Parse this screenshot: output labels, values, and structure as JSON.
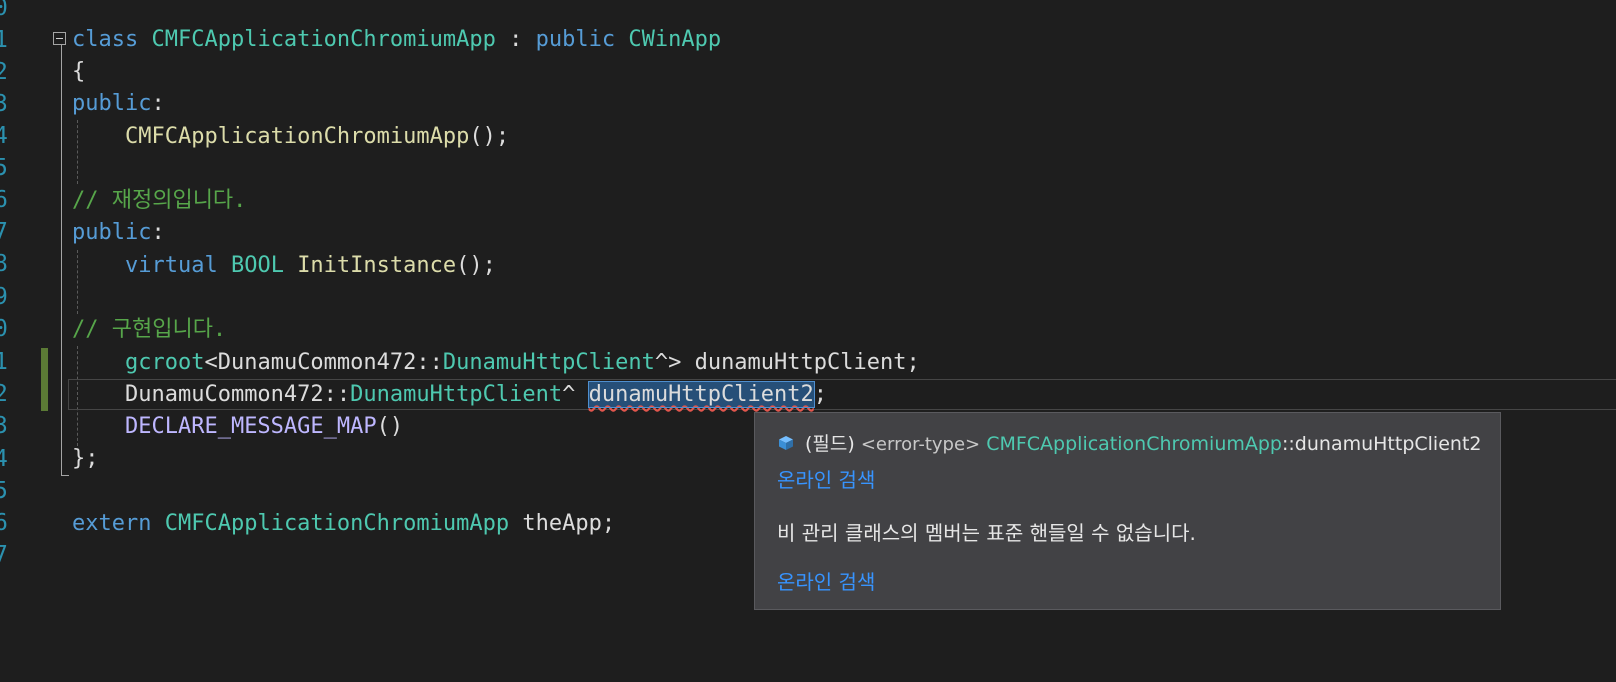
{
  "line_numbers": [
    "0",
    "1",
    "2",
    "3",
    "4",
    "5",
    "6",
    "7",
    "8",
    "9",
    "0",
    "1",
    "2",
    "3",
    "4",
    "5",
    "6",
    "7"
  ],
  "code": {
    "l1": {
      "kw_class": "class",
      "class_name": "CMFCApplicationChromiumApp",
      "colon": " : ",
      "kw_public": "public",
      "base": "CWinApp"
    },
    "l2": {
      "brace": "{"
    },
    "l3": {
      "kw": "public",
      "colon": ":"
    },
    "l4": {
      "ctor": "CMFCApplicationChromiumApp",
      "rest": "();"
    },
    "l6": {
      "comment": "// 재정의입니다."
    },
    "l7": {
      "kw": "public",
      "colon": ":"
    },
    "l8": {
      "kw_virtual": "virtual",
      "type": "BOOL",
      "fn": "InitInstance",
      "rest": "();"
    },
    "l10": {
      "comment": "// 구현입니다."
    },
    "l11": {
      "gcroot": "gcroot",
      "lt": "<",
      "ns": "DunamuCommon472",
      "sep": "::",
      "cls": "DunamuHttpClient",
      "gt": "^>",
      "name": " dunamuHttpClient;"
    },
    "l12": {
      "ns": "DunamuCommon472",
      "sep": "::",
      "cls": "DunamuHttpClient",
      "hat": "^ ",
      "selected": "dunamuHttpClient2",
      "semi": ";"
    },
    "l13": {
      "macro": "DECLARE_MESSAGE_MAP",
      "rest": "()"
    },
    "l14": {
      "close": "};"
    },
    "l16": {
      "kw_extern": "extern",
      "type": "CMFCApplicationChromiumApp",
      "rest": " theApp;"
    }
  },
  "tooltip": {
    "kind": "(필드)",
    "error_type": "<error-type>",
    "class_name": "CMFCApplicationChromiumApp",
    "member": "::dunamuHttpClient2",
    "link1": "온라인 검색",
    "message": "비 관리 클래스의 멤버는 표준 핸들일 수 없습니다.",
    "link2": "온라인 검색"
  },
  "colors": {
    "background": "#1e1e1e",
    "keyword": "#569cd6",
    "type": "#4ec9b0",
    "function": "#dcdcaa",
    "comment": "#57a64a",
    "link": "#3794ff"
  }
}
